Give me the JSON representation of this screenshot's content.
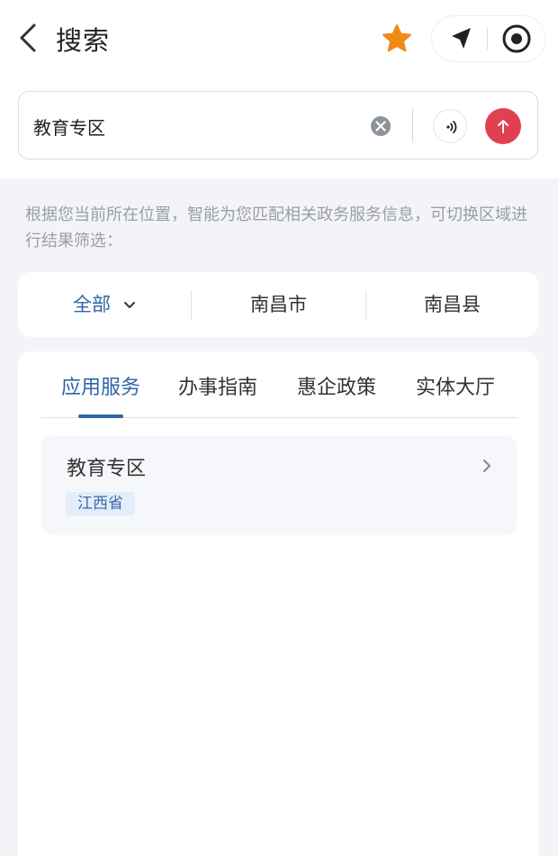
{
  "header": {
    "title": "搜索",
    "icons": [
      "back-icon",
      "star-icon",
      "navigation-arrow-icon",
      "target-icon"
    ],
    "star_color": "#f08a17"
  },
  "search": {
    "value": "教育专区",
    "placeholder": "",
    "icons": [
      "clear-icon",
      "voice-icon",
      "submit-arrow-icon"
    ],
    "submit_color": "#e0404f"
  },
  "hint_text": "根据您当前所在位置，智能为您匹配相关政务服务信息，可切换区域进行结果筛选：",
  "regions": {
    "selected": "全部",
    "options": [
      "南昌市",
      "南昌县"
    ]
  },
  "tabs": [
    {
      "label": "应用服务",
      "active": true
    },
    {
      "label": "办事指南",
      "active": false
    },
    {
      "label": "惠企政策",
      "active": false
    },
    {
      "label": "实体大厅",
      "active": false
    }
  ],
  "accent_color": "#2f65a7",
  "results": [
    {
      "title": "教育专区",
      "tag": "江西省"
    }
  ]
}
